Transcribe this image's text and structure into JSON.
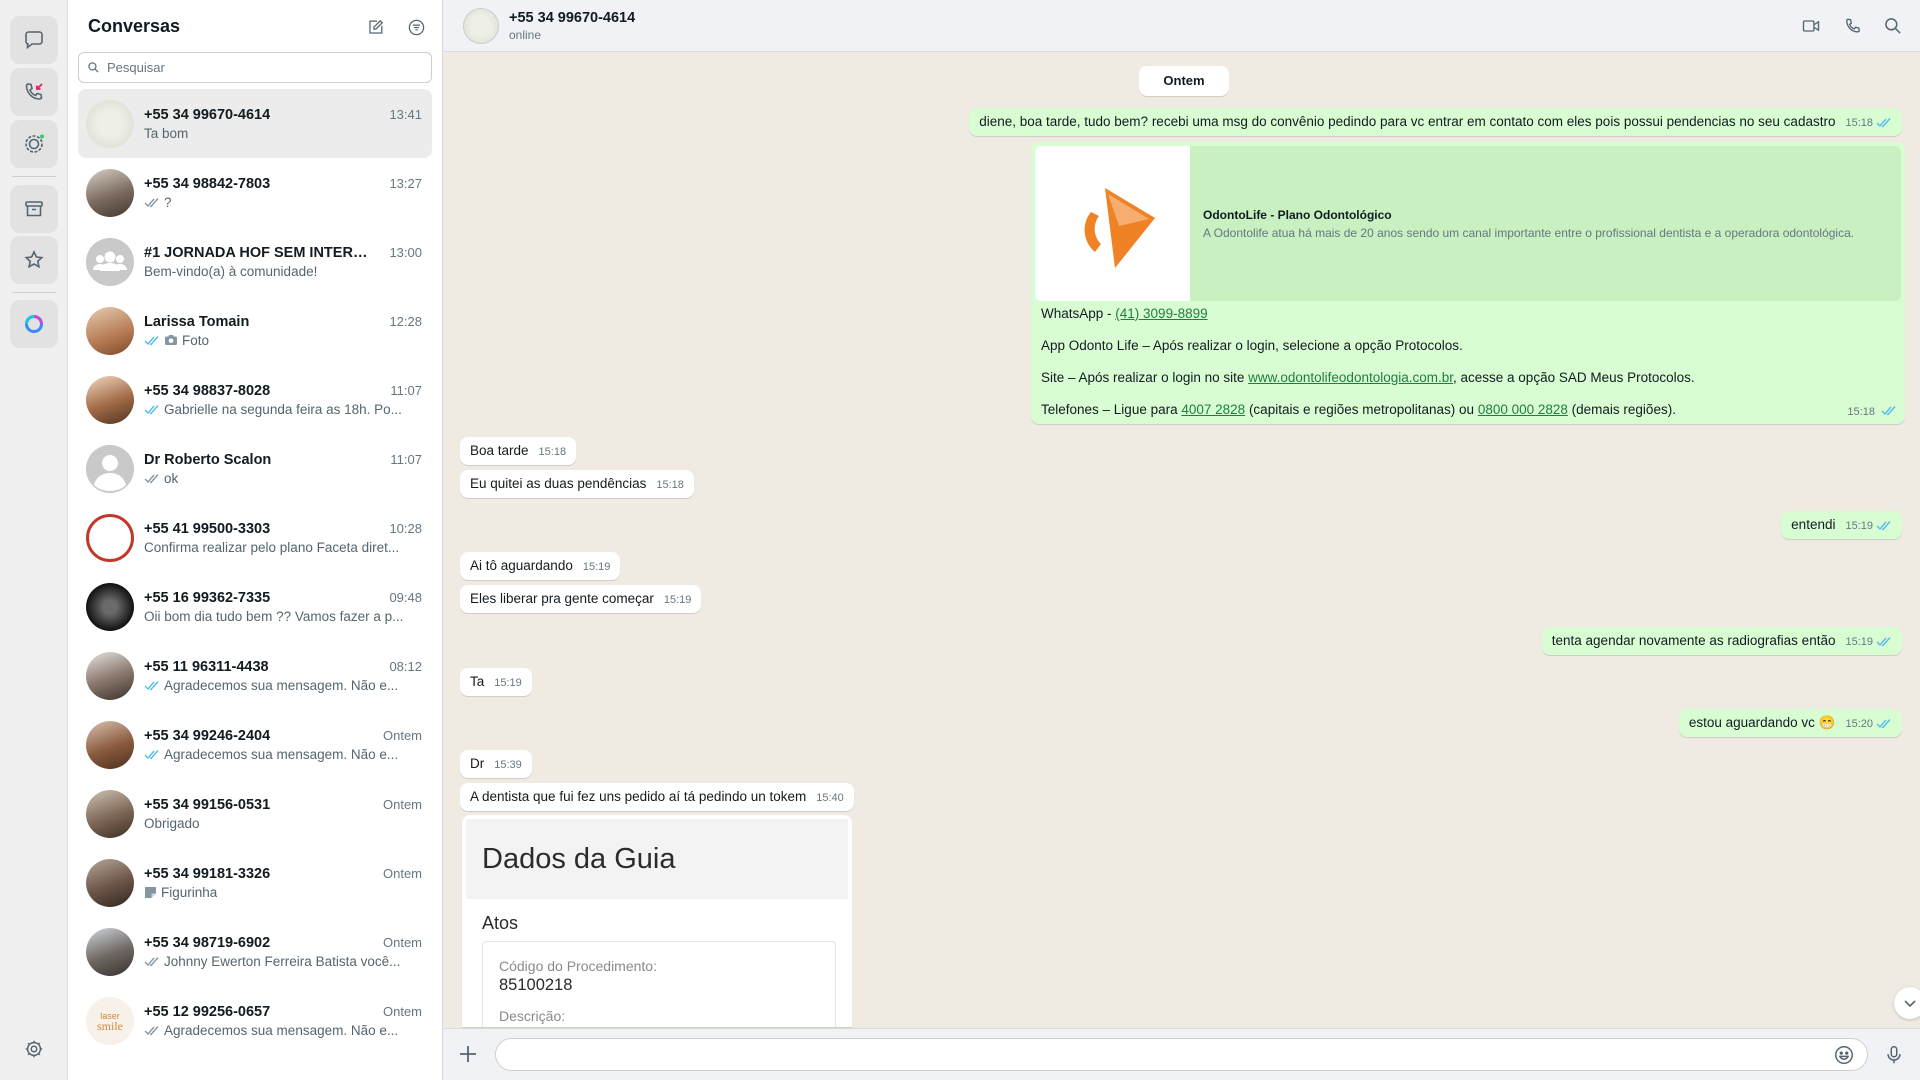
{
  "colors": {
    "accent": "#25d366",
    "outgoing_bubble": "#d9fdd3",
    "read_tick": "#53bdeb",
    "missed_call": "#e91e63",
    "link": "#1e7e3e"
  },
  "rail": {
    "icons": [
      "chat-bubble-icon",
      "phone-missed-icon",
      "status-icon",
      "archive-icon",
      "star-icon",
      "meta-ai-icon",
      "gear-icon"
    ]
  },
  "sidebar": {
    "title": "Conversas",
    "search_placeholder": "Pesquisar",
    "chats": [
      {
        "name": "+55 34 99670-4614",
        "time": "13:41",
        "preview": "Ta bom",
        "tick": "none",
        "active": true
      },
      {
        "name": "+55 34 98842-7803",
        "time": "13:27",
        "preview": "?",
        "tick": "grey"
      },
      {
        "name": "#1 JORNADA HOF SEM INTERCO...",
        "time": "13:00",
        "preview": "Bem-vindo(a) à comunidade!",
        "tick": "none"
      },
      {
        "name": "Larissa Tomain",
        "time": "12:28",
        "preview": "Foto",
        "tick": "blue",
        "camera": true
      },
      {
        "name": "+55 34 98837-8028",
        "time": "11:07",
        "preview": "Gabrielle na segunda feira as 18h. Po...",
        "tick": "blue"
      },
      {
        "name": "Dr Roberto Scalon",
        "time": "11:07",
        "preview": "ok",
        "tick": "grey"
      },
      {
        "name": "+55 41 99500-3303",
        "time": "10:28",
        "preview": "Confirma realizar pelo plano Faceta diret...",
        "tick": "none"
      },
      {
        "name": "+55 16 99362-7335",
        "time": "09:48",
        "preview": "Oii bom dia tudo bem ?? Vamos fazer a p...",
        "tick": "none"
      },
      {
        "name": "+55 11 96311-4438",
        "time": "08:12",
        "preview": "Agradecemos sua mensagem. Não e...",
        "tick": "blue"
      },
      {
        "name": "+55 34 99246-2404",
        "time": "Ontem",
        "preview": "Agradecemos sua mensagem. Não e...",
        "tick": "blue"
      },
      {
        "name": "+55 34 99156-0531",
        "time": "Ontem",
        "preview": "Obrigado",
        "tick": "none"
      },
      {
        "name": "+55 34 99181-3326",
        "time": "Ontem",
        "preview": "Figurinha",
        "tick": "none",
        "sticker": true
      },
      {
        "name": "+55 34 98719-6902",
        "time": "Ontem",
        "preview": "Johnny Ewerton Ferreira Batista você...",
        "tick": "grey"
      },
      {
        "name": "+55 12 99256-0657",
        "time": "Ontem",
        "preview": "Agradecemos sua mensagem. Não e...",
        "tick": "grey"
      }
    ]
  },
  "conversation": {
    "title": "+55 34 99670-4614",
    "status": "online",
    "date_separator": "Ontem",
    "messages": [
      {
        "dir": "out",
        "text": "diene, boa tarde, tudo bem? recebi uma msg do convênio pedindo para vc entrar em contato com eles pois possui pendencias no seu cadastro",
        "time": "15:18"
      },
      {
        "dir": "in",
        "text": "Boa tarde",
        "time": "15:18"
      },
      {
        "dir": "in",
        "text": "Eu quitei as duas pendências",
        "time": "15:18"
      },
      {
        "dir": "out",
        "text": "entendi",
        "time": "15:19"
      },
      {
        "dir": "in",
        "text": "Ai tô aguardando",
        "time": "15:19"
      },
      {
        "dir": "in",
        "text": "Eles liberar pra gente começar",
        "time": "15:19"
      },
      {
        "dir": "out",
        "text": "tenta agendar novamente as radiografias então",
        "time": "15:19"
      },
      {
        "dir": "in",
        "text": "Ta",
        "time": "15:19"
      },
      {
        "dir": "out",
        "text": "estou aguardando vc 😁",
        "time": "15:20"
      },
      {
        "dir": "in",
        "text": "Dr",
        "time": "15:39"
      },
      {
        "dir": "in",
        "text": "A dentista que fui fez uns pedido aí tá pedindo un tokem",
        "time": "15:40"
      }
    ],
    "link_card": {
      "preview_title": "OdontoLife - Plano Odontológico",
      "preview_desc": "A Odontolife atua há mais de 20 anos sendo um canal importante entre o profissional dentista e a operadora odontológica.",
      "line1_prefix": "WhatsApp - ",
      "line1_link": "(41) 3099-8899",
      "line2": "App Odonto Life – Após realizar o login, selecione a opção Protocolos.",
      "line3_prefix": "Site – Após realizar o login no site ",
      "line3_link": "www.odontolifeodontologia.com.br",
      "line3_suffix": ", acesse a opção SAD Meus Protocolos.",
      "line4_prefix": "Telefones – Ligue para ",
      "line4_link1": "4007 2828",
      "line4_mid": " (capitais e regiões metropolitanas) ou ",
      "line4_link2": "0800 000 2828",
      "line4_suffix": " (demais regiões).",
      "time": "15:18"
    },
    "guia_image": {
      "title": "Dados da Guia",
      "subtitle": "Atos",
      "label1": "Código do Procedimento:",
      "value1": "85100218",
      "label2": "Descrição:"
    }
  }
}
